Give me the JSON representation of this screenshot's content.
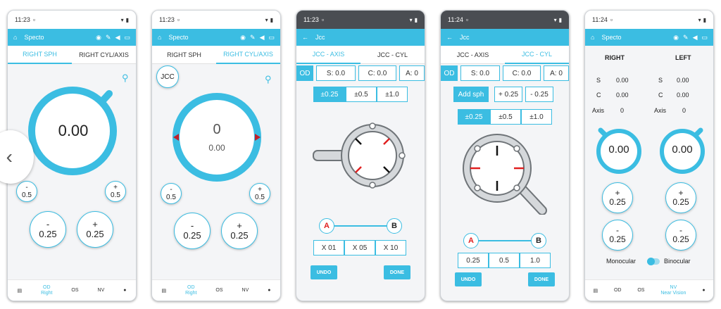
{
  "screens": [
    {
      "status_time": "11:23",
      "app_title": "Specto",
      "tabs": [
        "RIGHT SPH",
        "RIGHT CYL/AXIS"
      ],
      "dial_value": "0.00",
      "small_minus": [
        "-",
        "0.5"
      ],
      "small_plus": [
        "+",
        "0.5"
      ],
      "big_minus": [
        "-",
        "0.25"
      ],
      "big_plus": [
        "+",
        "0.25"
      ],
      "nav": [
        "OD",
        "Right",
        "OS",
        "NV"
      ]
    },
    {
      "status_time": "11:23",
      "app_title": "Specto",
      "tabs": [
        "RIGHT SPH",
        "RIGHT CYL/AXIS"
      ],
      "jcc_label": "JCC",
      "dial_axis": "0",
      "dial_value": "0.00",
      "small_minus": [
        "-",
        "0.5"
      ],
      "small_plus": [
        "+",
        "0.5"
      ],
      "big_minus": [
        "-",
        "0.25"
      ],
      "big_plus": [
        "+",
        "0.25"
      ],
      "nav": [
        "OD",
        "Right",
        "OS",
        "NV"
      ]
    },
    {
      "status_time": "11:23",
      "app_title": "Jcc",
      "tabs": [
        "JCC - AXIS",
        "JCC - CYL"
      ],
      "od": "OD",
      "readout": [
        "S: 0.0",
        "C: 0.0",
        "A: 0"
      ],
      "steps": [
        "±0.25",
        "±0.5",
        "±1.0"
      ],
      "a": "A",
      "b": "B",
      "x_options": [
        "X 01",
        "X 05",
        "X 10"
      ],
      "undo": "UNDO",
      "done": "DONE"
    },
    {
      "status_time": "11:24",
      "app_title": "Jcc",
      "tabs": [
        "JCC - AXIS",
        "JCC - CYL"
      ],
      "od": "OD",
      "readout": [
        "S: 0.0",
        "C: 0.0",
        "A: 0"
      ],
      "add_sph": "Add sph",
      "sph_steps": [
        "+ 0.25",
        "- 0.25"
      ],
      "steps": [
        "±0.25",
        "±0.5",
        "±1.0"
      ],
      "a": "A",
      "b": "B",
      "x_options": [
        "0.25",
        "0.5",
        "1.0"
      ],
      "undo": "UNDO",
      "done": "DONE"
    },
    {
      "status_time": "11:24",
      "app_title": "Specto",
      "right": "RIGHT",
      "left": "LEFT",
      "rows": [
        [
          "S",
          "0.00"
        ],
        [
          "C",
          "0.00"
        ],
        [
          "Axis",
          "0"
        ]
      ],
      "dial_right": "0.00",
      "dial_left": "0.00",
      "plus": [
        "+",
        "0.25"
      ],
      "minus": [
        "-",
        "0.25"
      ],
      "monocular": "Monocular",
      "binocular": "Binocular",
      "nav": [
        "OD",
        "OS",
        "NV",
        "Near Vision"
      ]
    }
  ],
  "colors": {
    "accent": "#3bbde2",
    "red": "#e02020"
  }
}
